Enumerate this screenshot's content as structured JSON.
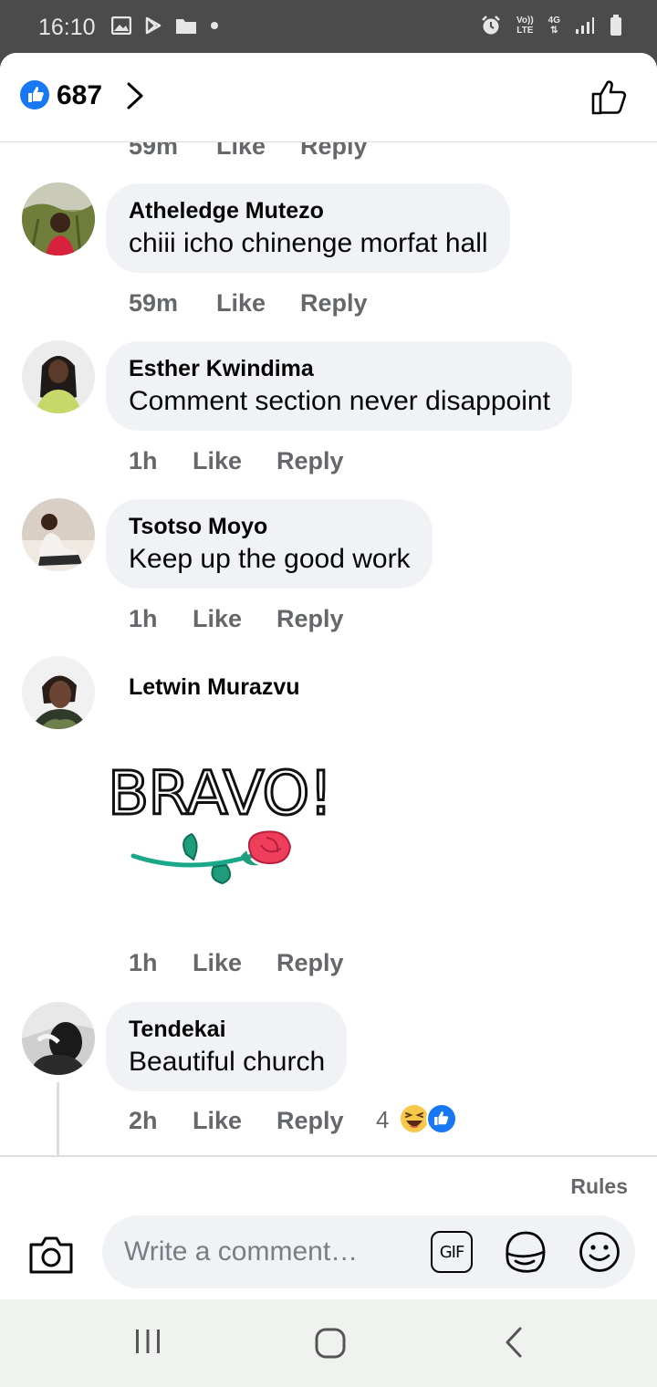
{
  "status_bar": {
    "time": "16:10",
    "left_icons": [
      "gallery-icon",
      "play-store-icon",
      "folder-icon",
      "dot-icon"
    ],
    "right_icons": [
      "alarm-icon",
      "volte-icon",
      "4g-data-icon",
      "signal-icon",
      "battery-icon"
    ],
    "volte_label_top": "Vo))",
    "volte_label_bottom": "LTE",
    "network_label": "4G"
  },
  "header": {
    "like_count": "687",
    "like_icon": "thumbs-up-icon",
    "chevron": "chevron-right-icon"
  },
  "comments": [
    {
      "time": "59m",
      "like_label": "Like",
      "reply_label": "Reply",
      "partial": true
    },
    {
      "author": "Atheledge Mutezo",
      "text": "chiii icho chinenge morfat hall",
      "time": "59m",
      "like_label": "Like",
      "reply_label": "Reply"
    },
    {
      "author": "Esther Kwindima",
      "text": "Comment section never disappoint",
      "time": "1h",
      "like_label": "Like",
      "reply_label": "Reply"
    },
    {
      "author": "Tsotso Moyo",
      "text": "Keep up the good work",
      "time": "1h",
      "like_label": "Like",
      "reply_label": "Reply"
    },
    {
      "author": "Letwin Murazvu",
      "sticker_text": "BRAVO!",
      "time": "1h",
      "like_label": "Like",
      "reply_label": "Reply"
    },
    {
      "author": "Tendekai",
      "text": "Beautiful church",
      "time": "2h",
      "like_label": "Like",
      "reply_label": "Reply",
      "reaction_count": "4",
      "reactions": [
        "haha-reaction-icon",
        "like-reaction-icon"
      ]
    }
  ],
  "footer": {
    "rules_label": "Rules",
    "comment_placeholder": "Write a comment…",
    "gif_label": "GIF"
  },
  "colors": {
    "accent": "#1877f2",
    "bubble": "#f0f2f5",
    "secondary_text": "#65676b",
    "status_bar": "#4b4b4b"
  }
}
